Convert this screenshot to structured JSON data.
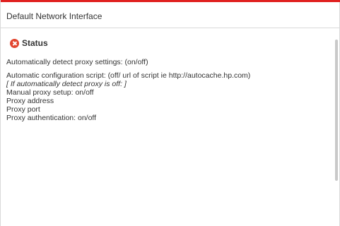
{
  "header": {
    "title": "Default Network Interface",
    "accent_color": "#e0201f"
  },
  "status": {
    "label": "Status",
    "icon": "error-circle-icon",
    "icon_color": "#e2452f"
  },
  "lines": [
    "Automatically detect proxy settings: (on/off)",
    "Automatic configuration script: (off/ url of script ie http://autocache.hp.com)",
    "[ If automatically detect proxy is off: ]",
    "Manual proxy setup: on/off",
    "Proxy address",
    "Proxy port",
    "Proxy authentication: on/off"
  ]
}
